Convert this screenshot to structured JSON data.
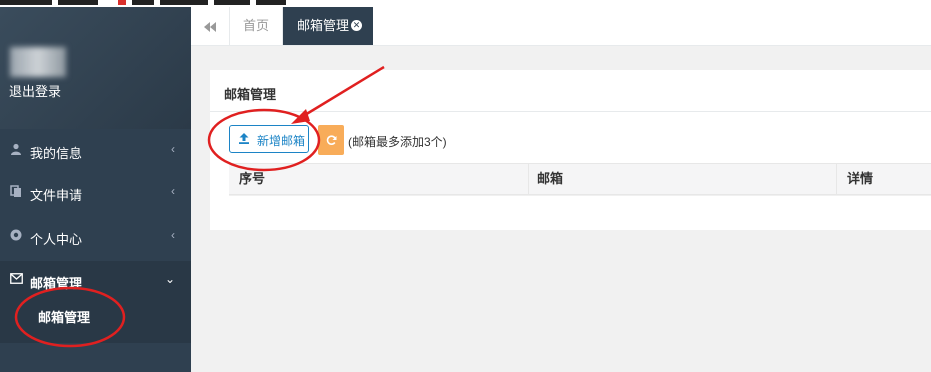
{
  "sidebar": {
    "logout_label": "退出登录",
    "items": [
      {
        "label": "我的信息",
        "icon": "user-icon"
      },
      {
        "label": "文件申请",
        "icon": "copy-icon"
      },
      {
        "label": "个人中心",
        "icon": "chrome-icon"
      },
      {
        "label": "邮箱管理",
        "icon": "envelope-icon"
      }
    ],
    "sub_items": [
      {
        "label": "邮箱管理"
      }
    ]
  },
  "tabs": {
    "items": [
      {
        "label": "首页"
      },
      {
        "label": "邮箱管理"
      }
    ],
    "active_index": 1
  },
  "panel": {
    "title": "邮箱管理",
    "add_button_label": "新增邮箱",
    "hint": "(邮箱最多添加3个)",
    "columns": [
      "序号",
      "邮箱",
      "详情"
    ],
    "rows": []
  },
  "colors": {
    "sidebar_bg": "#2f4050",
    "primary": "#1c84c6",
    "warning": "#f8ac59",
    "annotation_red": "#e02020"
  }
}
